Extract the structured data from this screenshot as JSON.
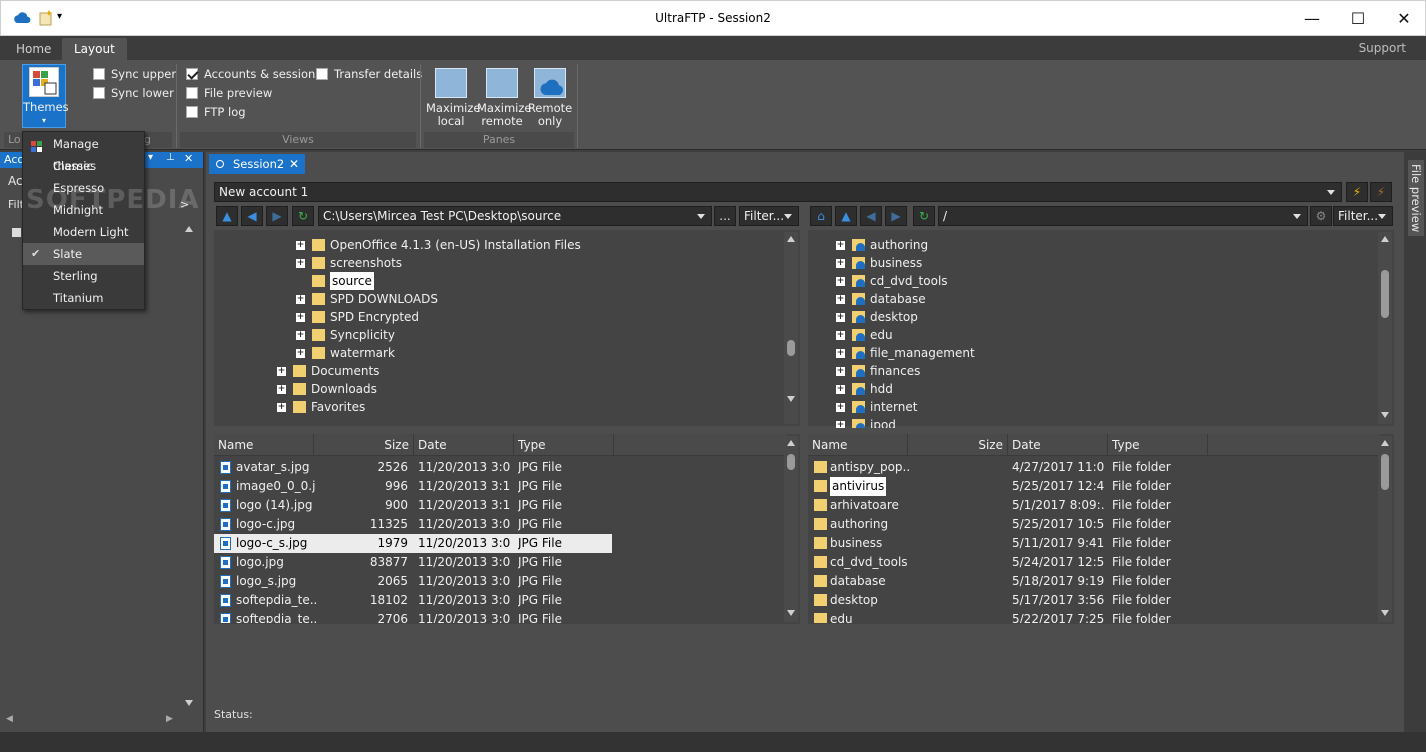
{
  "window": {
    "title": "UltraFTP - Session2"
  },
  "ribbon": {
    "tabs": [
      "Home",
      "Layout"
    ],
    "support": "Support",
    "themes_label": "Themes",
    "sync_upper": "Sync upper",
    "sync_lower": "Sync lower",
    "views": {
      "accounts_sessions": "Accounts & sessions",
      "transfer_details": "Transfer details",
      "file_preview": "File preview",
      "ftp_log": "FTP log",
      "group_label": "Views"
    },
    "panes": {
      "maximize_local": [
        "Maximize",
        "local"
      ],
      "maximize_remote": [
        "Maximize",
        "remote"
      ],
      "remote_only": [
        "Remote",
        "only"
      ],
      "group_label": "Panes"
    },
    "group_label_lo": "Lo",
    "group_label_g": "g"
  },
  "left_panel": {
    "title": "Acc",
    "row1": "Ac",
    "row2": "Filt",
    "more": ">"
  },
  "theme_menu": {
    "items": [
      "Manage themes",
      "Classic",
      "Espresso",
      "Midnight",
      "Modern Light",
      "Slate",
      "Sterling",
      "Titanium"
    ],
    "checked": "Slate"
  },
  "watermark": "SOFTPEDIA",
  "session": {
    "tab_label": "Session2",
    "account": "New account 1",
    "local_path": "C:\\Users\\Mircea Test PC\\Desktop\\source",
    "remote_path": "/",
    "filter_label": "Filter...",
    "ellipsis": "...",
    "local_tree": [
      {
        "name": "OpenOffice 4.1.3 (en-US) Installation Files",
        "level": 2,
        "plus": true
      },
      {
        "name": "screenshots",
        "level": 2,
        "plus": true
      },
      {
        "name": "source",
        "level": 2,
        "plus": false,
        "selected": true
      },
      {
        "name": "SPD DOWNLOADS",
        "level": 2,
        "plus": true
      },
      {
        "name": "SPD Encrypted",
        "level": 2,
        "plus": true
      },
      {
        "name": "Syncplicity",
        "level": 2,
        "plus": true
      },
      {
        "name": "watermark",
        "level": 2,
        "plus": true
      },
      {
        "name": "Documents",
        "level": 1,
        "plus": true
      },
      {
        "name": "Downloads",
        "level": 1,
        "plus": true
      },
      {
        "name": "Favorites",
        "level": 1,
        "plus": true
      }
    ],
    "remote_tree": [
      "authoring",
      "business",
      "cd_dvd_tools",
      "database",
      "desktop",
      "edu",
      "file_management",
      "finances",
      "hdd",
      "internet",
      "ipod"
    ],
    "local_columns": [
      "Name",
      "Size",
      "Date",
      "Type"
    ],
    "remote_columns": [
      "Name",
      "Size",
      "Date",
      "Type"
    ],
    "local_files": [
      {
        "name": "avatar_s.jpg",
        "size": "2526",
        "date": "11/20/2013 3:0...",
        "type": "JPG File"
      },
      {
        "name": "image0_0_0.j...",
        "size": "996",
        "date": "11/20/2013 3:1...",
        "type": "JPG File"
      },
      {
        "name": "logo (14).jpg",
        "size": "900",
        "date": "11/20/2013 3:1...",
        "type": "JPG File"
      },
      {
        "name": "logo-c.jpg",
        "size": "11325",
        "date": "11/20/2013 3:0...",
        "type": "JPG File"
      },
      {
        "name": "logo-c_s.jpg",
        "size": "1979",
        "date": "11/20/2013 3:0...",
        "type": "JPG File",
        "highlight": true
      },
      {
        "name": "logo.jpg",
        "size": "83877",
        "date": "11/20/2013 3:0...",
        "type": "JPG File"
      },
      {
        "name": "logo_s.jpg",
        "size": "2065",
        "date": "11/20/2013 3:0...",
        "type": "JPG File"
      },
      {
        "name": "softepdia_te...",
        "size": "18102",
        "date": "11/20/2013 3:0...",
        "type": "JPG File"
      },
      {
        "name": "softepdia_te...",
        "size": "2706",
        "date": "11/20/2013 3:0...",
        "type": "JPG File"
      }
    ],
    "remote_files": [
      {
        "name": "antispy_pop...",
        "size": "",
        "date": "4/27/2017 11:0...",
        "type": "File folder"
      },
      {
        "name": "antivirus",
        "size": "",
        "date": "5/25/2017 12:4...",
        "type": "File folder",
        "selected": true
      },
      {
        "name": "arhivatoare",
        "size": "",
        "date": "5/1/2017 8:09:...",
        "type": "File folder"
      },
      {
        "name": "authoring",
        "size": "",
        "date": "5/25/2017 10:5...",
        "type": "File folder"
      },
      {
        "name": "business",
        "size": "",
        "date": "5/11/2017 9:41...",
        "type": "File folder"
      },
      {
        "name": "cd_dvd_tools",
        "size": "",
        "date": "5/24/2017 12:5...",
        "type": "File folder"
      },
      {
        "name": "database",
        "size": "",
        "date": "5/18/2017 9:19...",
        "type": "File folder"
      },
      {
        "name": "desktop",
        "size": "",
        "date": "5/17/2017 3:56...",
        "type": "File folder"
      },
      {
        "name": "edu",
        "size": "",
        "date": "5/22/2017 7:25...",
        "type": "File folder"
      }
    ],
    "status_label": "Status:"
  },
  "right_strip": {
    "label": "File preview"
  },
  "colors": {
    "accent": "#1b73c9",
    "background": "#3f3f3f",
    "ribbon": "#535353"
  }
}
